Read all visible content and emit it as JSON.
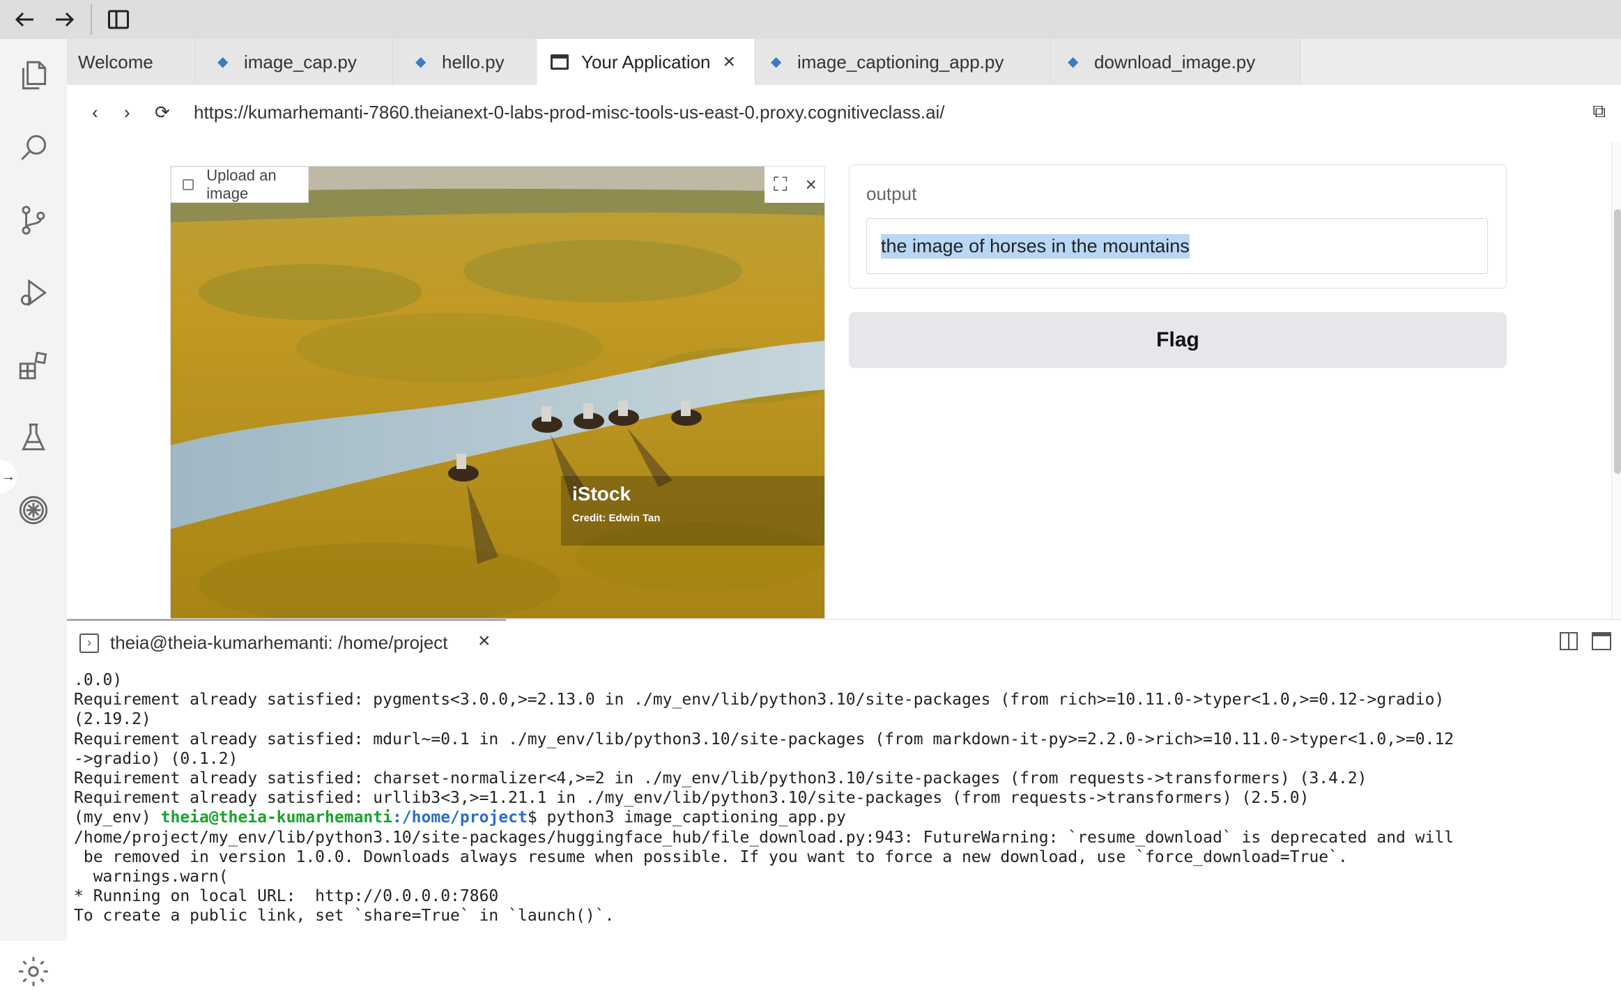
{
  "tabs": [
    {
      "label": "Welcome"
    },
    {
      "label": "image_cap.py"
    },
    {
      "label": "hello.py"
    },
    {
      "label": "Your Application"
    },
    {
      "label": "image_captioning_app.py"
    },
    {
      "label": "download_image.py"
    }
  ],
  "browser": {
    "url": "https://kumarhemanti-7860.theianext-0-labs-prod-misc-tools-us-east-0.proxy.cognitiveclass.ai/"
  },
  "app": {
    "upload_label": "Upload an image",
    "watermark_brand": "iStock",
    "watermark_credit": "Credit:  Edwin Tan",
    "output_label": "output",
    "output_value": "the image of horses in the mountains",
    "flag_label": "Flag"
  },
  "terminal": {
    "title": "theia@theia-kumarhemanti: /home/project",
    "lines": [
      ".0.0)",
      "Requirement already satisfied: pygments<3.0.0,>=2.13.0 in ./my_env/lib/python3.10/site-packages (from rich>=10.11.0->typer<1.0,>=0.12->gradio)",
      "(2.19.2)",
      "Requirement already satisfied: mdurl~=0.1 in ./my_env/lib/python3.10/site-packages (from markdown-it-py>=2.2.0->rich>=10.11.0->typer<1.0,>=0.12",
      "->gradio) (0.1.2)",
      "Requirement already satisfied: charset-normalizer<4,>=2 in ./my_env/lib/python3.10/site-packages (from requests->transformers) (3.4.2)",
      "Requirement already satisfied: urllib3<3,>=1.21.1 in ./my_env/lib/python3.10/site-packages (from requests->transformers) (2.5.0)"
    ],
    "prompt_env": "(my_env) ",
    "prompt_user": "theia@theia-kumarhemanti",
    "prompt_path": ":/home/project",
    "prompt_cmd": "$ python3 image_captioning_app.py",
    "lines_after": [
      "/home/project/my_env/lib/python3.10/site-packages/huggingface_hub/file_download.py:943: FutureWarning: `resume_download` is deprecated and will",
      " be removed in version 1.0.0. Downloads always resume when possible. If you want to force a new download, use `force_download=True`.",
      "  warnings.warn(",
      "* Running on local URL:  http://0.0.0.0:7860",
      "",
      "To create a public link, set `share=True` in `launch()`."
    ]
  }
}
